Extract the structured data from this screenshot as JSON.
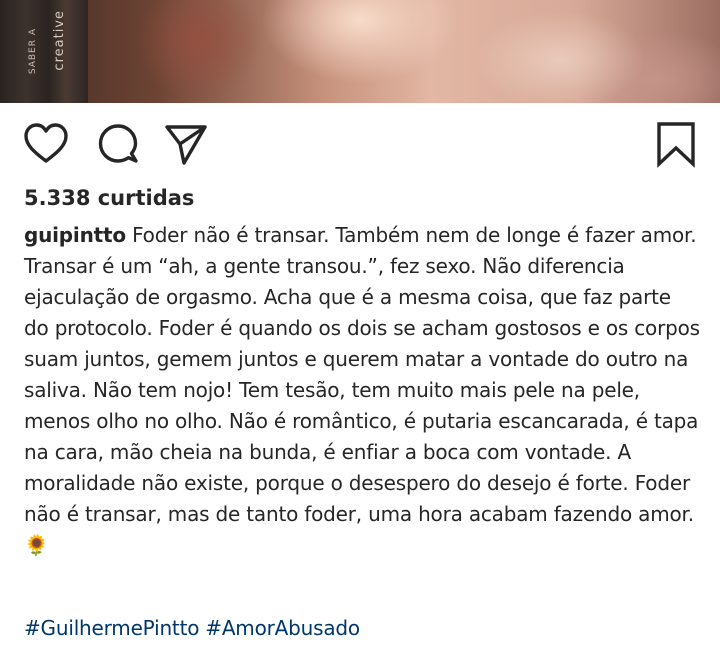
{
  "photo": {
    "book_spine_text": "creative",
    "book_spine_small": "SABER A"
  },
  "actions": {
    "icons": [
      "heart-icon",
      "comment-icon",
      "share-icon",
      "bookmark-icon"
    ]
  },
  "likes": "5.338 curtidas",
  "caption": {
    "username": "guipintto",
    "text": "Foder não é transar. Também nem de longe é fazer amor. Transar é um “ah, a gente transou.”, fez sexo. Não diferencia ejaculação de orgasmo. Acha que é a mesma coisa, que faz parte do protocolo. Foder é quando os dois se acham gostosos e os corpos suam juntos, gemem juntos e querem matar a vontade do outro na saliva. Não tem nojo! Tem tesão, tem muito mais pele na pele, menos olho no olho. Não é romântico, é putaria escancarada, é tapa na cara, mão cheia na bunda, é enfiar a boca com vontade. A moralidade não existe, porque o desespero do desejo é forte. Foder não é transar, mas de tanto foder, uma hora acabam fazendo amor.",
    "emoji": "🌻"
  },
  "hashtags": [
    "#GuilhermePintto",
    "#AmorAbusado"
  ],
  "colors": {
    "text": "#262626",
    "hashtag": "#00376b",
    "background": "#ffffff"
  }
}
